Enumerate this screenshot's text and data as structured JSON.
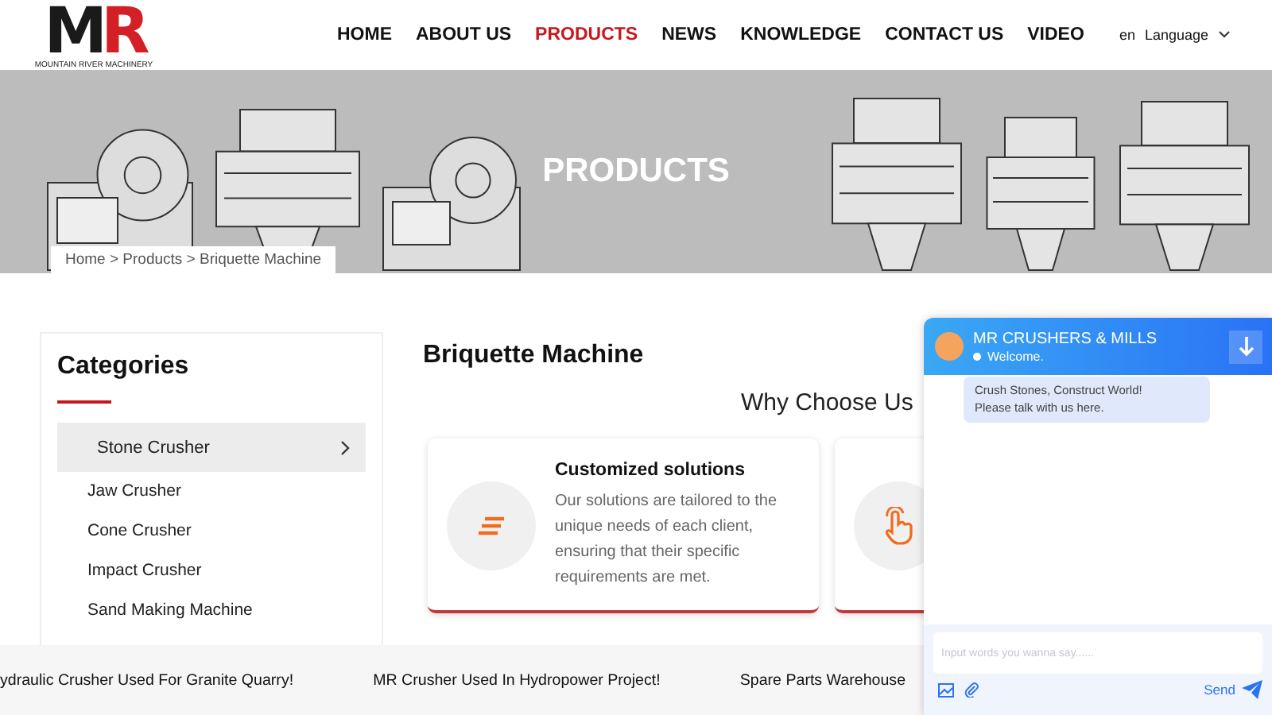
{
  "header": {
    "logo": {
      "letters": "MR",
      "tagline": "MOUNTAIN RIVER MACHINERY"
    },
    "nav": [
      {
        "label": "HOME",
        "selected": false
      },
      {
        "label": "ABOUT US",
        "selected": false
      },
      {
        "label": "PRODUCTS",
        "selected": true
      },
      {
        "label": "NEWS",
        "selected": false
      },
      {
        "label": "KNOWLEDGE",
        "selected": false
      },
      {
        "label": "CONTACT US",
        "selected": false
      },
      {
        "label": "VIDEO",
        "selected": false
      }
    ],
    "language": {
      "code": "en",
      "label": "Language"
    }
  },
  "banner": {
    "title": "PRODUCTS",
    "breadcrumb": "Home > Products > Briquette Machine"
  },
  "sidebar": {
    "title": "Categories",
    "items": [
      {
        "label": "Stone Crusher",
        "selected": true,
        "children": [
          {
            "label": "Jaw Crusher",
            "selected": false
          },
          {
            "label": "Cone Crusher",
            "selected": false
          },
          {
            "label": "Impact Crusher",
            "selected": false
          },
          {
            "label": "Sand Making Machine",
            "selected": false
          }
        ]
      }
    ]
  },
  "main": {
    "title": "Briquette Machine",
    "section_title": "Why Choose Us",
    "cards": [
      {
        "kind": "lines",
        "title": "Customized solutions",
        "text": "Our solutions are tailored to the unique needs of each client, ensuring that their specific requirements are met."
      },
      {
        "kind": "hand"
      }
    ]
  },
  "ticker": [
    "ydraulic Crusher Used For Granite Quarry!",
    "MR Crusher Used In Hydropower Project!",
    "Spare Parts Warehouse"
  ],
  "chat": {
    "title": "MR CRUSHERS & MILLS",
    "status": "Welcome.",
    "message": "Crush Stones, Construct World!\nPlease talk with us here.",
    "placeholder": "Input words you wanna say......",
    "send": "Send"
  }
}
